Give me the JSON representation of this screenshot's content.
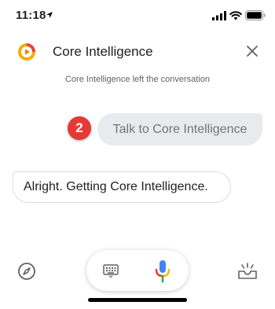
{
  "status_bar": {
    "time": "11:18"
  },
  "header": {
    "title": "Core Intelligence"
  },
  "conversation": {
    "system_message": "Core Intelligence left the conversation",
    "user_message": "Talk to Core Intelligence",
    "user_badge": "2",
    "assistant_message": "Alright. Getting Core Intelligence."
  },
  "colors": {
    "badge": "#e53935",
    "user_bubble": "#e8eaed",
    "logo_orange": "#f9ab00",
    "logo_red": "#ea4335"
  },
  "icons": {
    "close": "close-icon",
    "compass": "compass-icon",
    "keyboard": "keyboard-icon",
    "mic": "mic-icon",
    "inbox": "inbox-icon"
  }
}
